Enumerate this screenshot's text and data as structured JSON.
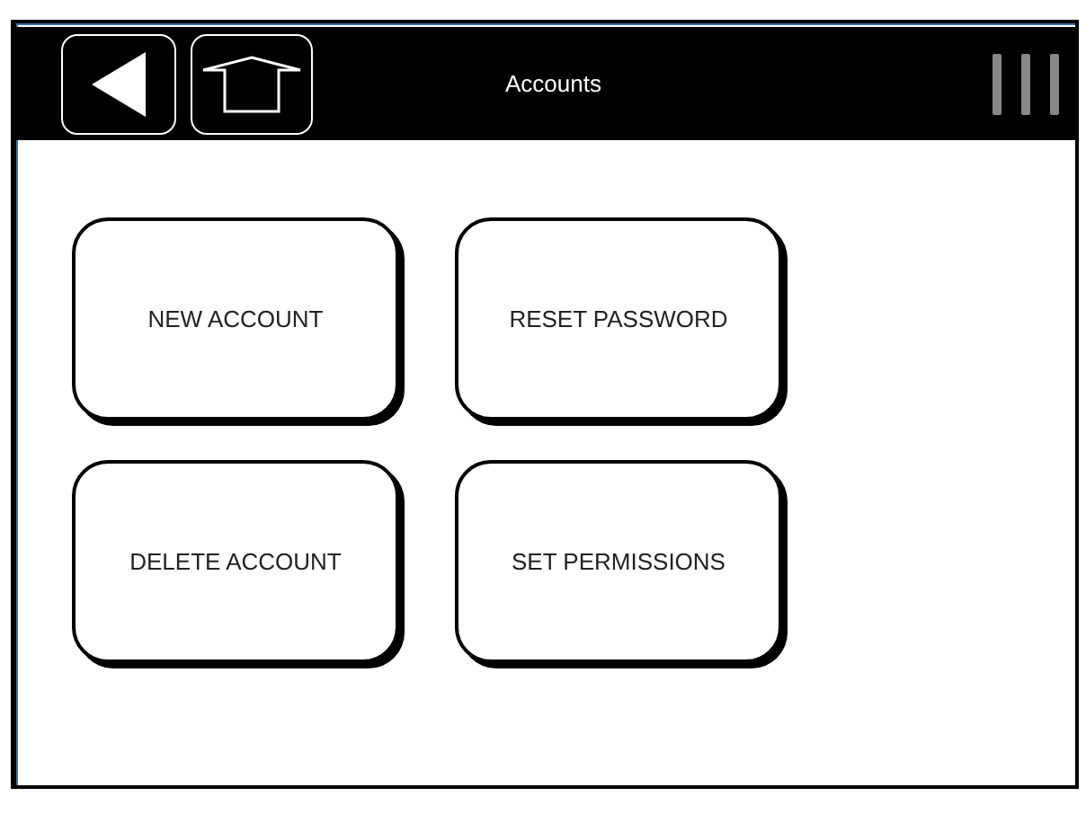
{
  "header": {
    "title": "Accounts"
  },
  "buttons": [
    {
      "label": "NEW ACCOUNT"
    },
    {
      "label": "RESET PASSWORD"
    },
    {
      "label": "DELETE ACCOUNT"
    },
    {
      "label": "SET PERMISSIONS"
    }
  ]
}
